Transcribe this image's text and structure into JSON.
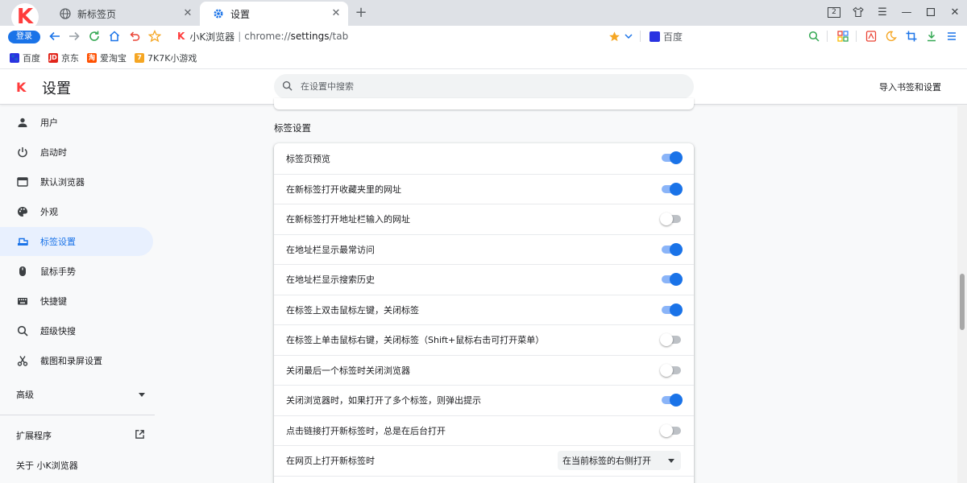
{
  "browser": {
    "logo_login": "登录",
    "tabs": [
      {
        "title": "新标签页",
        "icon": "globe-icon"
      },
      {
        "title": "设置",
        "icon": "gear-icon"
      }
    ],
    "tab_count": "2",
    "address": {
      "site": "小K浏览器",
      "url_prefix": "chrome://",
      "url_bold": "settings",
      "url_suffix": "/tab"
    },
    "search_engine": "百度",
    "bookmarks": [
      {
        "label": "百度",
        "icon": "baidu-paw-icon",
        "color": "#2932e1"
      },
      {
        "label": "京东",
        "icon": "jd-icon",
        "color": "#e1251b"
      },
      {
        "label": "爱淘宝",
        "icon": "taobao-icon",
        "color": "#ff5000"
      },
      {
        "label": "7K7K小游戏",
        "icon": "7k7k-icon",
        "color": "#f5a623"
      }
    ]
  },
  "settings": {
    "title": "设置",
    "search_placeholder": "在设置中搜索",
    "import_link": "导入书签和设置",
    "sidebar": {
      "items": [
        {
          "label": "用户",
          "icon": "person-icon"
        },
        {
          "label": "启动时",
          "icon": "power-icon"
        },
        {
          "label": "默认浏览器",
          "icon": "browser-window-icon"
        },
        {
          "label": "外观",
          "icon": "palette-icon"
        },
        {
          "label": "标签设置",
          "icon": "tab-icon",
          "active": true
        },
        {
          "label": "鼠标手势",
          "icon": "mouse-icon"
        },
        {
          "label": "快捷键",
          "icon": "keyboard-icon"
        },
        {
          "label": "超级快搜",
          "icon": "search-icon"
        },
        {
          "label": "截图和录屏设置",
          "icon": "scissors-icon"
        }
      ],
      "advanced": "高级",
      "extensions": "扩展程序",
      "about": "关于 小K浏览器"
    },
    "section_title": "标签设置",
    "rows": [
      {
        "label": "标签页预览",
        "type": "toggle",
        "on": true
      },
      {
        "label": "在新标签打开收藏夹里的网址",
        "type": "toggle",
        "on": true
      },
      {
        "label": "在新标签打开地址栏输入的网址",
        "type": "toggle",
        "on": false
      },
      {
        "label": "在地址栏显示最常访问",
        "type": "toggle",
        "on": true
      },
      {
        "label": "在地址栏显示搜索历史",
        "type": "toggle",
        "on": true
      },
      {
        "label": "在标签上双击鼠标左键，关闭标签",
        "type": "toggle",
        "on": true
      },
      {
        "label": "在标签上单击鼠标右键，关闭标签（Shift+鼠标右击可打开菜单）",
        "type": "toggle",
        "on": false
      },
      {
        "label": "关闭最后一个标签时关闭浏览器",
        "type": "toggle",
        "on": false
      },
      {
        "label": "关闭浏览器时，如果打开了多个标签，则弹出提示",
        "type": "toggle",
        "on": true
      },
      {
        "label": "点击链接打开新标签时，总是在后台打开",
        "type": "toggle",
        "on": false
      },
      {
        "label": "在网页上打开新标签时",
        "type": "select",
        "value": "在当前标签的右侧打开"
      }
    ]
  }
}
